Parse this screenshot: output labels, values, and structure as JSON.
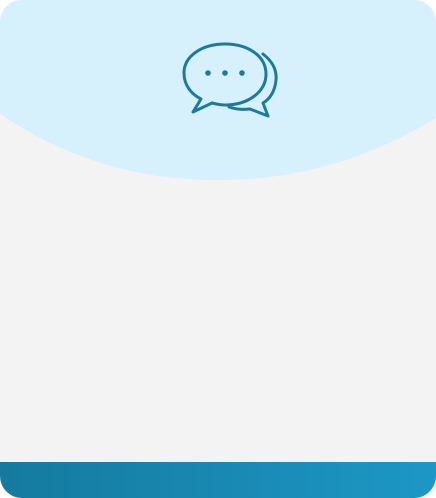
{
  "card": {
    "icon": "chat-bubbles-icon",
    "colors": {
      "header_background": "#d6f1fb",
      "body_background": "#f3f3f3",
      "icon_stroke": "#1e7a9c",
      "footer_gradient_start": "#157a9e",
      "footer_gradient_end": "#1d97c6"
    }
  }
}
